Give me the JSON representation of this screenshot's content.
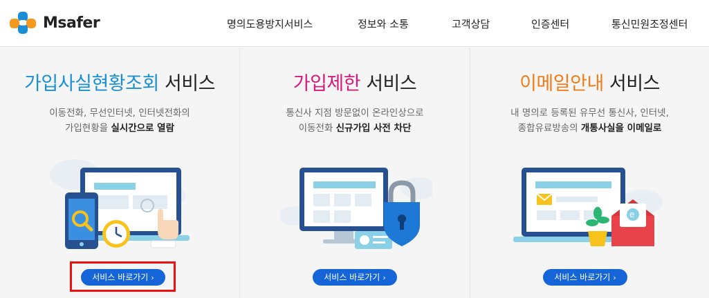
{
  "header": {
    "logo_text": "Msafer",
    "nav": [
      {
        "label": "명의도용방지서비스"
      },
      {
        "label": "정보와 소통"
      },
      {
        "label": "고객상담"
      },
      {
        "label": "인증센터"
      },
      {
        "label": "통신민원조정센터"
      }
    ]
  },
  "panels": [
    {
      "title_highlight": "가입사실현황조회",
      "title_rest": " 서비스",
      "highlight_color": "#1a8fd6",
      "desc_line1": "이동전화, 무선인터넷, 인터넷전화의",
      "desc_line2_plain": "가입현황을 ",
      "desc_line2_bold": "실시간으로 열람",
      "desc_line2_after": "",
      "button_label": "서비스 바로가기",
      "button_icon": "chevron-right-icon"
    },
    {
      "title_highlight": "가입제한",
      "title_rest": " 서비스",
      "highlight_color": "#d6197a",
      "desc_line1": "통신사 지점 방문없이 온라인상으로",
      "desc_line2_plain": "이동전화 ",
      "desc_line2_bold": "신규가입 사전 차단",
      "desc_line2_after": "",
      "button_label": "서비스 바로가기",
      "button_icon": "chevron-right-icon"
    },
    {
      "title_highlight": "이메일안내",
      "title_rest": " 서비스",
      "highlight_color": "#f07d1a",
      "desc_line1": "내 명의로 등록된 유무선 통신사, 인터넷,",
      "desc_line2_plain": "종합유료방송의 ",
      "desc_line2_bold": "개통사실을 이메일로",
      "desc_line2_after": "",
      "button_label": "서비스 바로가기",
      "button_icon": "chevron-right-icon"
    }
  ],
  "colors": {
    "button_bg": "#1665d8",
    "focus_outline": "#ee1111",
    "panel_bg": "#f5f5f5"
  }
}
